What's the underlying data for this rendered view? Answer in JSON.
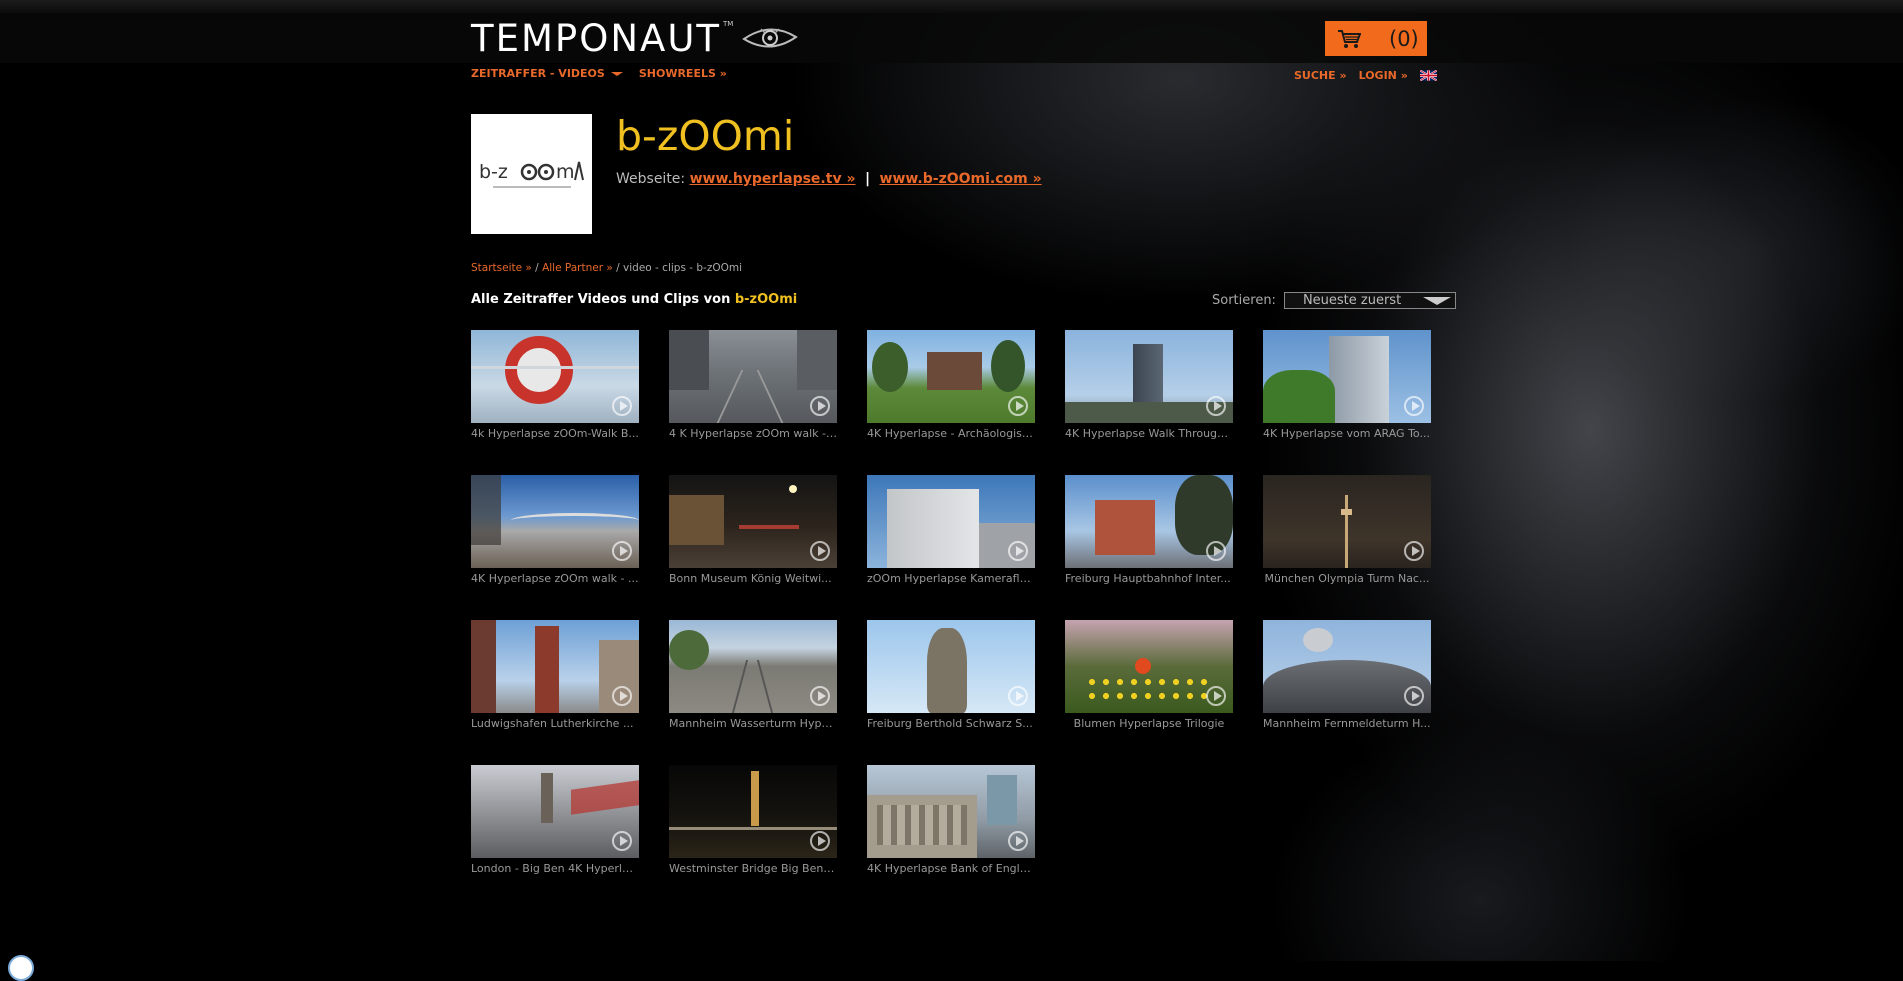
{
  "header": {
    "logo_text": "TEMPONAUT",
    "logo_tm": "TM",
    "cart_count": "(0)"
  },
  "nav": {
    "videos_label": "ZEITRAFFER - VIDEOS",
    "showreels_label": "SHOWREELS »",
    "search_label": "SUCHE »",
    "login_label": "LOGIN »"
  },
  "partner": {
    "name": "b-zOOmi",
    "website_label": "Webseite:",
    "link1": "www.hyperlapse.tv »",
    "separator": "|",
    "link2": "www.b-zOOmi.com »"
  },
  "breadcrumb": {
    "home": "Startseite »",
    "sep1": " / ",
    "partners": "Alle Partner »",
    "current": " / video - clips - b-zOOmi"
  },
  "section": {
    "heading_prefix": "Alle Zeitraffer Videos und Clips von ",
    "heading_name": "b-zOOmi"
  },
  "sort": {
    "label": "Sortieren:",
    "selected": "Neueste zuerst"
  },
  "colors": {
    "accent": "#e8692a",
    "title": "#f0c020",
    "cart": "#f26b1d"
  },
  "videos": [
    {
      "title": "4k Hyperlapse zOOm-Walk B..."
    },
    {
      "title": "4 K Hyperlapse zOOm walk - ..."
    },
    {
      "title": "4K Hyperlapse - Archäologisc..."
    },
    {
      "title": "4K Hyperlapse Walk Through..."
    },
    {
      "title": "4K Hyperlapse vom ARAG To..."
    },
    {
      "title": "4K Hyperlapse zOOm walk - ..."
    },
    {
      "title": "Bonn Museum König Weitwi..."
    },
    {
      "title": "zOOm Hyperlapse Kameraflu..."
    },
    {
      "title": "Freiburg Hauptbahnhof Inter..."
    },
    {
      "title": "München Olympia Turm Nac..."
    },
    {
      "title": "Ludwigshafen Lutherkirche ..."
    },
    {
      "title": "Mannheim Wasserturm Hype..."
    },
    {
      "title": "Freiburg Berthold Schwarz S..."
    },
    {
      "title": "Blumen Hyperlapse Trilogie"
    },
    {
      "title": "Mannheim Fernmeldeturm H..."
    },
    {
      "title": "London - Big Ben 4K Hyperla..."
    },
    {
      "title": "Westminster Bridge Big Ben ..."
    },
    {
      "title": "4K Hyperlapse Bank of Engla..."
    }
  ]
}
